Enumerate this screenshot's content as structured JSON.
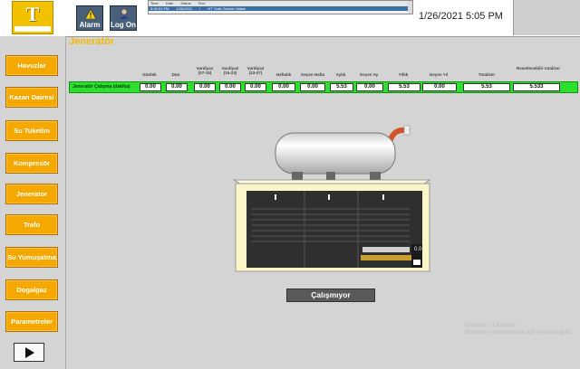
{
  "topbar": {
    "alarm_label": "Alarm",
    "logon_label": "Log On",
    "datetime": "1/26/2021 5:05 PM",
    "alarm_headers": [
      "Time",
      "Date",
      "Status",
      "Text"
    ],
    "alarm_row": [
      "5:05:51 PM",
      "1/26/2021",
      "I",
      "HT Trafo Sensör Hatası"
    ]
  },
  "nav": {
    "items": [
      "Havuzlar",
      "Kazan Dairesi",
      "Su Tuketim",
      "Kompresör",
      "Jenerator",
      "Trafo",
      "Su Yumuşatma",
      "Dogalgaz",
      "Parametreler"
    ]
  },
  "page": {
    "title": "Jeneratör",
    "row_label": "Jeneratör Çalışma (dakika)",
    "columns": [
      {
        "header": "Günlük",
        "value": "0.00"
      },
      {
        "header": "Dün",
        "value": "0.00"
      },
      {
        "header": "Vardiya1 (07-15)",
        "value": "0.00"
      },
      {
        "header": "Vardiya2 (15-23)",
        "value": "0.00"
      },
      {
        "header": "Vardiya3 (23-07)",
        "value": "0.00"
      },
      {
        "header": "Haftalık",
        "value": "0.00"
      },
      {
        "header": "Geçen Hafta",
        "value": "0.00"
      },
      {
        "header": "Aylık",
        "value": "5.53"
      },
      {
        "header": "Geçen Ay",
        "value": "0.00"
      },
      {
        "header": "Yıllık",
        "value": "5.53"
      },
      {
        "header": "Geçen Yıl",
        "value": "0.00"
      },
      {
        "header": "Totalizer",
        "value": "5.53"
      },
      {
        "header": "Resetlenebilir totalizer",
        "value": "5.533"
      }
    ],
    "panel_readout": "0.0",
    "status": "Çalışmıyor"
  },
  "watermark": {
    "line1": "Windows'u Etkinleştir",
    "line2": "Windows'u etkinleştirmek için Ayarlar'a gidin."
  },
  "colors": {
    "accent": "#f5a800",
    "title": "#f0b800",
    "run_bar": "#2de02d",
    "status_bg": "#5a5a5a",
    "panel_body": "#fbf6c8"
  }
}
